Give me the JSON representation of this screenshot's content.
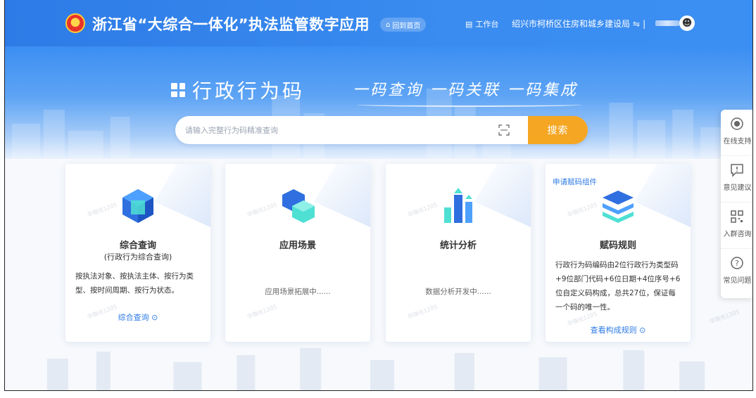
{
  "header": {
    "app_title": "浙江省“大综合一体化”执法监管数字应用",
    "home_label": "回到首页",
    "workbench_label": "工作台",
    "bureau_label": "绍兴市柯桥区住房和城乡建设局",
    "bureau_switch_icon": "switch-icon",
    "separator": "|"
  },
  "hero": {
    "title": "行政行为码",
    "slogan": "一码查询 一码关联 一码集成"
  },
  "search": {
    "placeholder": "请输入完整行为码精准查询",
    "button_label": "搜索"
  },
  "cards": [
    {
      "title": "综合查询",
      "subtitle": "(行政行为综合查询)",
      "description": "按执法对象、按执法主体、按行为类型、按时间周期、按行为状态。",
      "link": "综合查询"
    },
    {
      "title": "应用场景",
      "description": "应用场景拓展中......"
    },
    {
      "title": "统计分析",
      "description": "数据分析开发中......"
    },
    {
      "apply_link": "申请赋码组件",
      "title": "赋码规则",
      "description": "行政行为码编码由2位行政行为类型码+9位部门代码+6位日期+4位序号+6位自定义码构成，总共27位，保证每一个码的唯一性。",
      "link": "查看构成规则"
    }
  ],
  "float_panel": [
    {
      "label": "在线支持",
      "icon": "headset-icon"
    },
    {
      "label": "意见建议",
      "icon": "feedback-icon"
    },
    {
      "label": "入群咨询",
      "icon": "qr-code-icon"
    },
    {
      "label": "常见问题",
      "icon": "question-icon"
    }
  ],
  "watermark": "华晓光1205",
  "colors": {
    "primary": "#2d7be6",
    "search_button": "#f5a623"
  }
}
